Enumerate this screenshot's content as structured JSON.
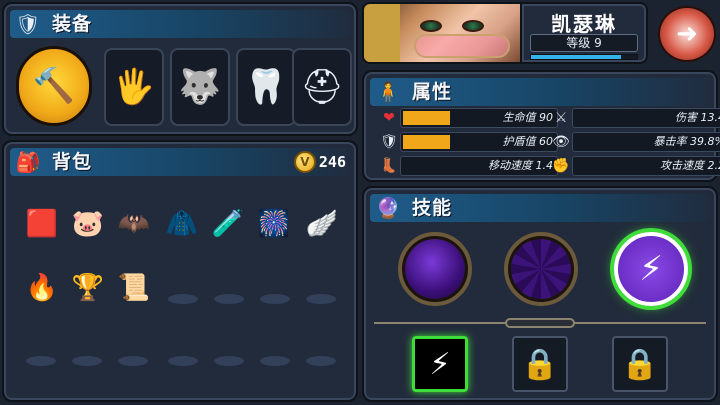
{
  "equipment": {
    "title": "装备",
    "header_icon": "armor-icon",
    "slots": [
      {
        "icon": "weapon-hammer-icon",
        "glyph": "🔨",
        "selected": true
      },
      {
        "icon": "glove-icon",
        "glyph": "🖐"
      },
      {
        "icon": "wolf-helmet-icon",
        "glyph": "🐺"
      },
      {
        "icon": "beast-fangs-icon",
        "glyph": "🦷"
      },
      {
        "icon": "knight-helmet-icon",
        "glyph": "⛑"
      }
    ]
  },
  "hero": {
    "name": "凯瑟琳",
    "level_label": "等级 9",
    "xp_fraction": 0.85,
    "back_icon": "back-arrow-icon"
  },
  "attributes": {
    "title": "属性",
    "header_icon": "character-icon",
    "stats": [
      {
        "label": "生命值 90",
        "icon": "heart-icon",
        "glyph": "❤",
        "fill": 0.3
      },
      {
        "label": "伤害 13.4",
        "icon": "sword-icon",
        "glyph": "⚔",
        "fill": 0
      },
      {
        "label": "护盾值 60",
        "icon": "shield-icon",
        "glyph": "🛡",
        "fill": 0.3
      },
      {
        "label": "暴击率 39.8%",
        "icon": "eye-icon",
        "glyph": "👁",
        "fill": 0
      },
      {
        "label": "移动速度 1.4",
        "icon": "boot-icon",
        "glyph": "👢",
        "fill": 0
      },
      {
        "label": "攻击速度 2.2",
        "icon": "fist-icon",
        "glyph": "✊",
        "fill": 0
      }
    ]
  },
  "backpack": {
    "title": "背包",
    "header_icon": "backpack-icon",
    "coins": "246",
    "coin_icon": "coin-icon",
    "coin_glyph": "V",
    "items": [
      {
        "icon": "red-cube-icon",
        "glyph": "🟥"
      },
      {
        "icon": "golden-pig-icon",
        "glyph": "🐷"
      },
      {
        "icon": "red-bat-icon",
        "glyph": "🦇"
      },
      {
        "icon": "gold-armor-icon",
        "glyph": "🧥"
      },
      {
        "icon": "potion-shield-icon",
        "glyph": "🧪"
      },
      {
        "icon": "firework-icon",
        "glyph": "🎆"
      },
      {
        "icon": "golden-wings-icon",
        "glyph": "🪽"
      },
      {
        "icon": "flame-orb-icon",
        "glyph": "🔥"
      },
      {
        "icon": "chalice-icon",
        "glyph": "🏆"
      },
      {
        "icon": "magic-scroll-icon",
        "glyph": "📜"
      }
    ]
  },
  "skills": {
    "title": "技能",
    "header_icon": "skill-orb-icon",
    "orbs": [
      {
        "icon": "dark-orb-icon"
      },
      {
        "icon": "rune-orb-icon"
      },
      {
        "icon": "lightning-orb-icon",
        "glyph": "⚡",
        "selected": true
      }
    ],
    "slots": [
      {
        "icon": "dash-skill-icon",
        "glyph": "⚡",
        "state": "active"
      },
      {
        "icon": "lock-icon",
        "glyph": "🔒",
        "state": "locked"
      },
      {
        "icon": "lock-icon",
        "glyph": "🔒",
        "state": "locked"
      }
    ]
  }
}
